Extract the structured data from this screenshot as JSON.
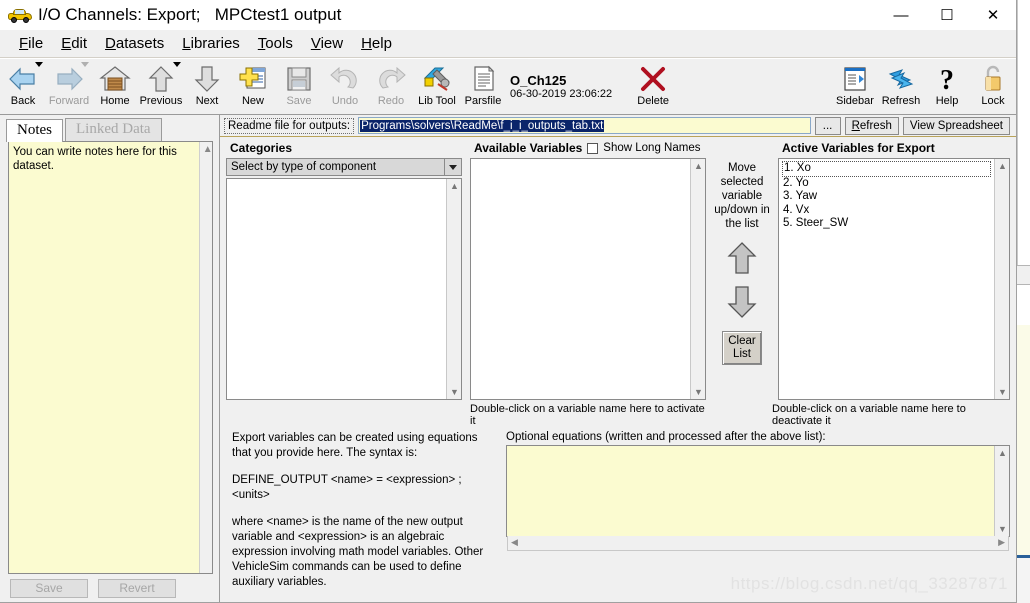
{
  "window": {
    "title": "I/O Channels: Export;   MPCtest1 output",
    "icon": "car-icon",
    "controls": {
      "minimize": "—",
      "maximize": "☐",
      "close": "✕"
    }
  },
  "menu": {
    "items": [
      {
        "label": "File",
        "accel": "F"
      },
      {
        "label": "Edit",
        "accel": "E"
      },
      {
        "label": "Datasets",
        "accel": "D"
      },
      {
        "label": "Libraries",
        "accel": "L"
      },
      {
        "label": "Tools",
        "accel": "T"
      },
      {
        "label": "View",
        "accel": "V"
      },
      {
        "label": "Help",
        "accel": "H"
      }
    ]
  },
  "toolbar": {
    "buttons": [
      {
        "label": "Back",
        "icon": "arrow-left-icon",
        "enabled": true,
        "dropdown": true
      },
      {
        "label": "Forward",
        "icon": "arrow-right-icon",
        "enabled": false,
        "dropdown": true
      },
      {
        "label": "Home",
        "icon": "home-icon",
        "enabled": true,
        "dropdown": false
      },
      {
        "label": "Previous",
        "icon": "arrow-up-icon",
        "enabled": true,
        "dropdown": true
      },
      {
        "label": "Next",
        "icon": "arrow-down-icon",
        "enabled": true,
        "dropdown": false
      },
      {
        "label": "New",
        "icon": "new-document-icon",
        "enabled": true,
        "dropdown": false
      },
      {
        "label": "Save",
        "icon": "floppy-disk-icon",
        "enabled": false,
        "dropdown": false
      },
      {
        "label": "Undo",
        "icon": "undo-arrow-icon",
        "enabled": false,
        "dropdown": false
      },
      {
        "label": "Redo",
        "icon": "redo-arrow-icon",
        "enabled": false,
        "dropdown": false
      },
      {
        "label": "Lib Tool",
        "icon": "wrench-icon",
        "enabled": true,
        "dropdown": false
      },
      {
        "label": "Parsfile",
        "icon": "parsfile-icon",
        "enabled": true,
        "dropdown": false
      }
    ],
    "file": {
      "name": "O_Ch125",
      "date": "06-30-2019 23:06:22"
    },
    "delete": {
      "label": "Delete",
      "icon": "red-x-icon"
    },
    "right_buttons": [
      {
        "label": "Sidebar",
        "icon": "sidebar-icon"
      },
      {
        "label": "Refresh",
        "icon": "refresh-icon"
      },
      {
        "label": "Help",
        "icon": "question-mark-icon"
      },
      {
        "label": "Lock",
        "icon": "padlock-icon"
      }
    ]
  },
  "left": {
    "tabs": [
      {
        "label": "Notes",
        "active": true
      },
      {
        "label": "Linked Data",
        "active": false
      }
    ],
    "notes": "You can write notes here for this dataset.",
    "buttons": [
      {
        "label": "Save",
        "enabled": false
      },
      {
        "label": "Revert",
        "enabled": false
      }
    ]
  },
  "path_row": {
    "label": "Readme file for outputs:",
    "value": "Programs\\solvers\\ReadMe\\f_i_i_outputs_tab.txt",
    "browse_label": "...",
    "refresh_label": "Refresh",
    "view_label": "View Spreadsheet"
  },
  "categories": {
    "header": "Categories",
    "selected": "Select by type of component",
    "items": []
  },
  "available": {
    "header": "Available Variables",
    "show_long_names_label": "Show Long Names",
    "show_long_names_checked": false,
    "items": [],
    "hint": "Double-click on a variable name here to activate it"
  },
  "move": {
    "text": "Move selected variable up/down in the list",
    "up_icon": "arrow-up-icon",
    "down_icon": "arrow-down-icon",
    "clear_label_1": "Clear",
    "clear_label_2": "List"
  },
  "active": {
    "header": "Active Variables for Export",
    "items": [
      "1. Xo",
      "2. Yo",
      "3. Yaw",
      "4. Vx",
      "5. Steer_SW"
    ],
    "hint": "Double-click on a variable name here to deactivate it"
  },
  "help": {
    "p1": "Export variables can be created using equations that you provide here. The syntax is:",
    "p2": "DEFINE_OUTPUT <name> = <expression> ; <units>",
    "p3": "where <name> is the name of the new output variable and <expression> is an algebraic expression involving math model variables. Other VehicleSim commands can be used to define auxiliary variables."
  },
  "equations": {
    "label": "Optional equations (written and processed after the above list):",
    "value": ""
  },
  "watermark": "https://blog.csdn.net/qq_33287871",
  "colors": {
    "window_bg": "#f0f0f0",
    "note_yellow": "#fbfbd0",
    "selection_blue": "#0a246a",
    "accent_gold": "#b9a35a"
  }
}
